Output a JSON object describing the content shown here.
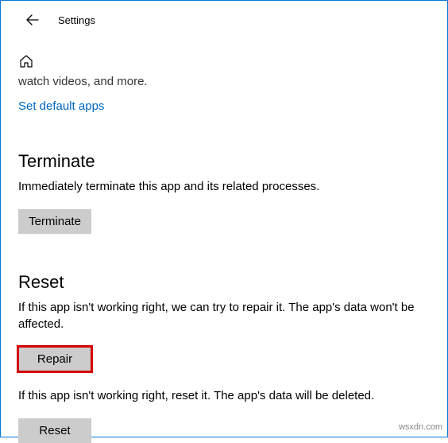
{
  "header": {
    "title": "Settings"
  },
  "truncated_line": "watch videos, and more.",
  "default_apps_link": "Set default apps",
  "terminate": {
    "heading": "Terminate",
    "desc": "Immediately terminate this app and its related processes.",
    "button": "Terminate"
  },
  "reset": {
    "heading": "Reset",
    "repair_desc": "If this app isn't working right, we can try to repair it. The app's data won't be affected.",
    "repair_button": "Repair",
    "reset_desc": "If this app isn't working right, reset it. The app's data will be deleted.",
    "reset_button": "Reset"
  },
  "watermark": "wsxdn.com"
}
